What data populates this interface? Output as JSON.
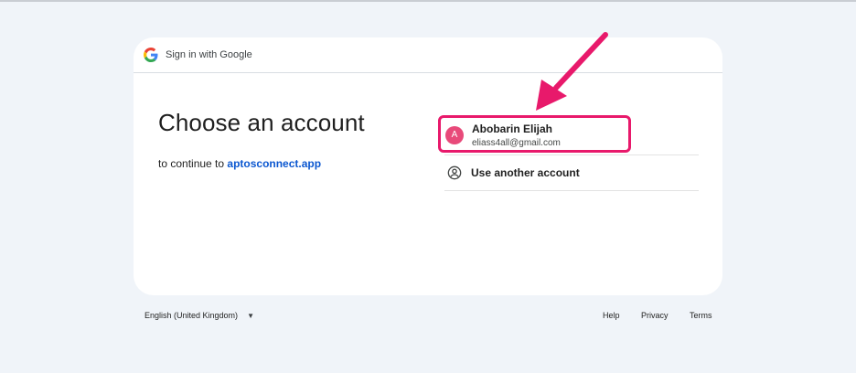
{
  "header": {
    "title": "Sign in with Google"
  },
  "main": {
    "title": "Choose an account",
    "subtitle_prefix": "to continue to ",
    "subtitle_link": "aptosconnect.app"
  },
  "accounts": [
    {
      "initial": "A",
      "name": "Abobarin Elijah",
      "email": "eliass4all@gmail.com"
    }
  ],
  "use_another": "Use another account",
  "footer": {
    "language": "English (United Kingdom)",
    "help": "Help",
    "privacy": "Privacy",
    "terms": "Terms"
  },
  "colors": {
    "accent": "#0b57d0",
    "annotation": "#e8196b",
    "avatar": "#e84a7a"
  },
  "icons": [
    "google-logo-icon",
    "person-circle-icon",
    "caret-down-icon"
  ]
}
